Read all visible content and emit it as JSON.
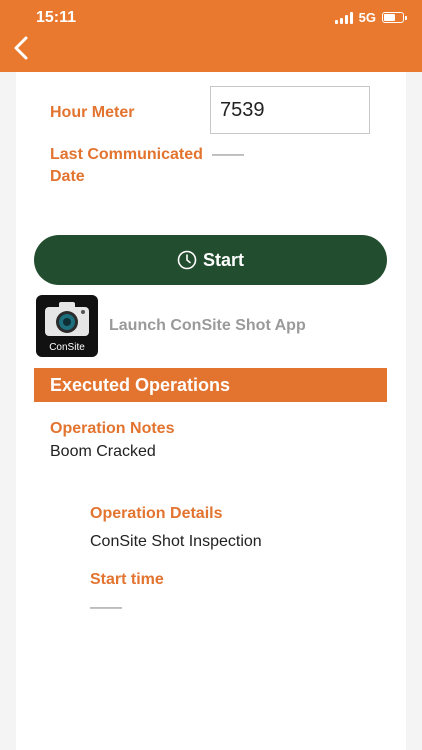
{
  "status_bar": {
    "time": "15:11",
    "network": "5G"
  },
  "header": {
    "back_icon": "chevron-left-icon"
  },
  "hour_meter": {
    "label": "Hour Meter",
    "value": "7539"
  },
  "last_communicated": {
    "label_line1": "Last Communicated",
    "label_line2": "Date",
    "value": "——"
  },
  "start_button": {
    "label": "Start",
    "icon": "clock-icon",
    "color": "#234d2f"
  },
  "app_launch": {
    "icon_brand": "ConSite",
    "label": "Launch ConSite Shot App"
  },
  "executed_operations": {
    "title": "Executed Operations",
    "notes_label": "Operation Notes",
    "notes_value": "Boom Cracked",
    "details_label": "Operation Details",
    "details_value": "ConSite Shot Inspection",
    "start_time_label": "Start time",
    "start_time_value": "——"
  },
  "colors": {
    "accent": "#e8792e",
    "label": "#e27430",
    "button": "#234d2f"
  }
}
